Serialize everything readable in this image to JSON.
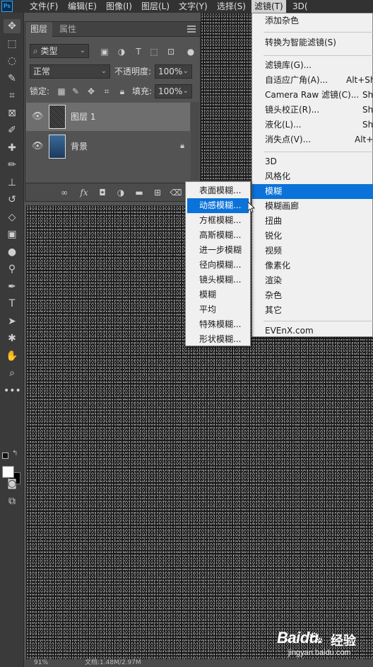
{
  "app": {
    "logo": "Ps"
  },
  "menubar": {
    "items": [
      "文件(F)",
      "编辑(E)",
      "图像(I)",
      "图层(L)",
      "文字(Y)",
      "选择(S)",
      "滤镜(T)",
      "3D("
    ]
  },
  "toolbar": {
    "tools": [
      "move-tool-icon",
      "marquee-tool-icon",
      "lasso-tool-icon",
      "quick-select-tool-icon",
      "crop-tool-icon",
      "frame-tool-icon",
      "eyedropper-tool-icon",
      "healing-brush-tool-icon",
      "brush-tool-icon",
      "clone-stamp-tool-icon",
      "history-brush-tool-icon",
      "eraser-tool-icon",
      "gradient-tool-icon",
      "blur-tool-icon",
      "dodge-tool-icon",
      "pen-tool-icon",
      "type-tool-icon",
      "path-select-tool-icon",
      "shape-tool-icon",
      "hand-tool-icon",
      "zoom-tool-icon",
      "more-tools-icon"
    ],
    "foreground_color": "#ffffff",
    "background_color": "#000000"
  },
  "layers_panel": {
    "tabs": [
      "图层",
      "属性"
    ],
    "filter_kind": "类型",
    "blend_mode": "正常",
    "opacity_label": "不透明度:",
    "opacity_value": "100%",
    "lock_label": "锁定:",
    "fill_label": "填充:",
    "fill_value": "100%",
    "layers": [
      {
        "name": "图层 1",
        "selected": true,
        "visible": true,
        "locked": false
      },
      {
        "name": "背景",
        "selected": false,
        "visible": true,
        "locked": true
      }
    ]
  },
  "filter_menu": {
    "items": [
      {
        "label": "添加杂色",
        "shortcut": ""
      },
      {
        "label": "转换为智能滤镜(S)",
        "shortcut": ""
      },
      {
        "label": "滤镜库(G)...",
        "shortcut": ""
      },
      {
        "label": "自适应广角(A)...",
        "shortcut": "Alt+Shi"
      },
      {
        "label": "Camera Raw 滤镜(C)...",
        "shortcut": "Shi"
      },
      {
        "label": "镜头校正(R)...",
        "shortcut": "Shi"
      },
      {
        "label": "液化(L)...",
        "shortcut": "Shi"
      },
      {
        "label": "消失点(V)...",
        "shortcut": "Alt+"
      },
      {
        "label": "3D",
        "shortcut": ""
      },
      {
        "label": "风格化",
        "shortcut": ""
      },
      {
        "label": "模糊",
        "shortcut": ""
      },
      {
        "label": "模糊画廊",
        "shortcut": ""
      },
      {
        "label": "扭曲",
        "shortcut": ""
      },
      {
        "label": "锐化",
        "shortcut": ""
      },
      {
        "label": "视频",
        "shortcut": ""
      },
      {
        "label": "像素化",
        "shortcut": ""
      },
      {
        "label": "渲染",
        "shortcut": ""
      },
      {
        "label": "杂色",
        "shortcut": ""
      },
      {
        "label": "其它",
        "shortcut": ""
      },
      {
        "label": "EVEnX.com",
        "shortcut": ""
      }
    ],
    "highlighted": "模糊"
  },
  "blur_submenu": {
    "items": [
      "表面模糊...",
      "动感模糊...",
      "方框模糊...",
      "高斯模糊...",
      "进一步模糊",
      "径向模糊...",
      "镜头模糊...",
      "模糊",
      "平均",
      "特殊模糊...",
      "形状模糊..."
    ],
    "highlighted": "动感模糊..."
  },
  "status": {
    "zoom": "91%",
    "doc_size": "文档:1.48M/2.97M"
  },
  "watermark": {
    "brand": "Baidu",
    "suffix": "经验",
    "url": "jingyan.baidu.com"
  },
  "colors": {
    "highlight": "#0a72d8",
    "panel_bg": "#535353",
    "menubar_bg": "#323232"
  }
}
